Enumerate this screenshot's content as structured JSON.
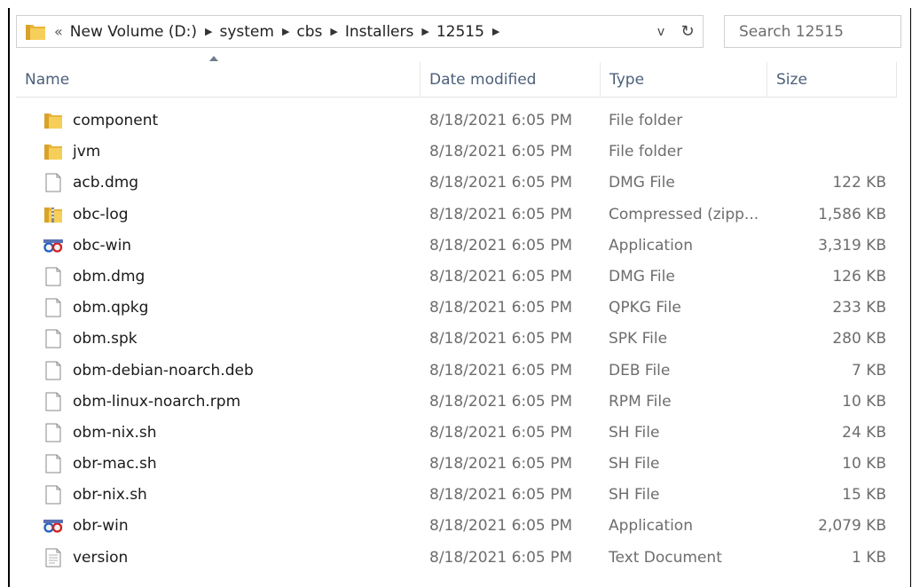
{
  "address": {
    "overflow_glyph": "«",
    "crumbs": [
      "New Volume (D:)",
      "system",
      "cbs",
      "Installers",
      "12515"
    ],
    "dropdown_glyph": "v",
    "refresh_glyph": "↻"
  },
  "search": {
    "placeholder": "Search 12515"
  },
  "columns": {
    "name": "Name",
    "date": "Date modified",
    "type": "Type",
    "size": "Size",
    "sorted_column": "name"
  },
  "files": [
    {
      "name": "component",
      "date": "8/18/2021 6:05 PM",
      "type": "File folder",
      "size": "",
      "icon": "folder-icon"
    },
    {
      "name": "jvm",
      "date": "8/18/2021 6:05 PM",
      "type": "File folder",
      "size": "",
      "icon": "folder-icon"
    },
    {
      "name": "acb.dmg",
      "date": "8/18/2021 6:05 PM",
      "type": "DMG File",
      "size": "122 KB",
      "icon": "file-icon"
    },
    {
      "name": "obc-log",
      "date": "8/18/2021 6:05 PM",
      "type": "Compressed (zipp...",
      "size": "1,586 KB",
      "icon": "zip-folder-icon"
    },
    {
      "name": "obc-win",
      "date": "8/18/2021 6:05 PM",
      "type": "Application",
      "size": "3,319 KB",
      "icon": "app-icon"
    },
    {
      "name": "obm.dmg",
      "date": "8/18/2021 6:05 PM",
      "type": "DMG File",
      "size": "126 KB",
      "icon": "file-icon"
    },
    {
      "name": "obm.qpkg",
      "date": "8/18/2021 6:05 PM",
      "type": "QPKG File",
      "size": "233 KB",
      "icon": "file-icon"
    },
    {
      "name": "obm.spk",
      "date": "8/18/2021 6:05 PM",
      "type": "SPK File",
      "size": "280 KB",
      "icon": "file-icon"
    },
    {
      "name": "obm-debian-noarch.deb",
      "date": "8/18/2021 6:05 PM",
      "type": "DEB File",
      "size": "7 KB",
      "icon": "file-icon"
    },
    {
      "name": "obm-linux-noarch.rpm",
      "date": "8/18/2021 6:05 PM",
      "type": "RPM File",
      "size": "10 KB",
      "icon": "file-icon"
    },
    {
      "name": "obm-nix.sh",
      "date": "8/18/2021 6:05 PM",
      "type": "SH File",
      "size": "24 KB",
      "icon": "file-icon"
    },
    {
      "name": "obr-mac.sh",
      "date": "8/18/2021 6:05 PM",
      "type": "SH File",
      "size": "10 KB",
      "icon": "file-icon"
    },
    {
      "name": "obr-nix.sh",
      "date": "8/18/2021 6:05 PM",
      "type": "SH File",
      "size": "15 KB",
      "icon": "file-icon"
    },
    {
      "name": "obr-win",
      "date": "8/18/2021 6:05 PM",
      "type": "Application",
      "size": "2,079 KB",
      "icon": "app-icon"
    },
    {
      "name": "version",
      "date": "8/18/2021 6:05 PM",
      "type": "Text Document",
      "size": "1 KB",
      "icon": "text-file-icon"
    }
  ],
  "colors": {
    "header_text": "#4c607a",
    "folder_yellow": "#e8b53a",
    "secondary_text": "#6d6d6d"
  }
}
